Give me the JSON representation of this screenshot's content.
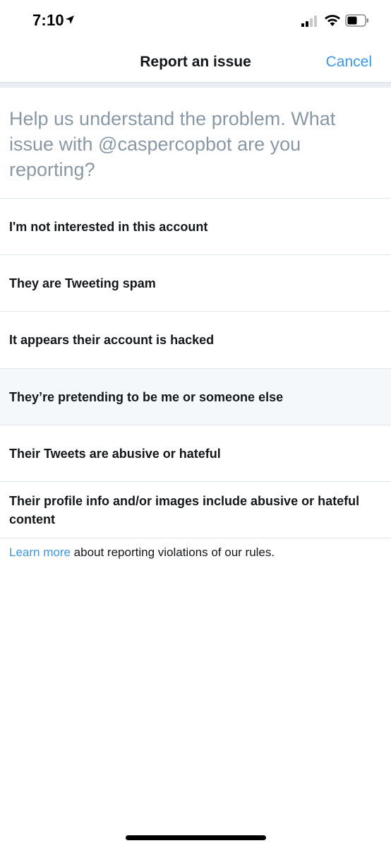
{
  "status_bar": {
    "time": "7:10",
    "location_icon": "location-arrow-icon",
    "signal_icon": "cellular-signal-icon",
    "wifi_icon": "wifi-icon",
    "battery_icon": "battery-icon"
  },
  "nav": {
    "title": "Report an issue",
    "cancel_label": "Cancel"
  },
  "prompt": "Help us understand the problem. What issue with @caspercopbot are you reporting?",
  "options": [
    {
      "label": "I'm not interested in this account"
    },
    {
      "label": "They are Tweeting spam"
    },
    {
      "label": "It appears their account is hacked"
    },
    {
      "label": "They’re pretending to be me or someone else",
      "highlighted": true
    },
    {
      "label": "Their Tweets are abusive or hateful"
    },
    {
      "label": "Their profile info and/or images include abusive or hateful content"
    }
  ],
  "footer": {
    "link_text": "Learn more",
    "rest_text": " about reporting violations of our rules."
  },
  "colors": {
    "accent": "#3e97e0",
    "prompt_text": "#8a98a5",
    "highlight_row": "#f5f8fa",
    "divider": "#e1e6ea"
  }
}
